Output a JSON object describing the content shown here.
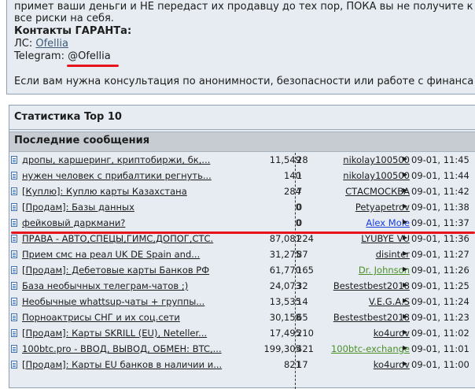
{
  "top": {
    "partial_line": "примет ваши деньги и НЕ передаст их продавцу до тех пор, ПОКА вы не получите к",
    "risk_line": "все риски на себя.",
    "contacts_heading": "Контакты ГАРАНТа:",
    "pm_label": "ЛС:",
    "pm_user": "Ofellia",
    "telegram_label": "Telegram:",
    "telegram_handle": "@Ofellia",
    "consult_line": "Если вам нужна консультация по анонимности, безопасности или работе с финанса"
  },
  "stats": {
    "title": "Статистика Top 10",
    "section": "Последние сообщения"
  },
  "posts": [
    {
      "title": "дропы, каршеринг, криптобиржи, бк,...",
      "views": "11,549",
      "replies": "28",
      "author": "nikolay100500",
      "author_color": "dark",
      "time": "09-01, 11:45"
    },
    {
      "title": "нужен человек с прибалтики регнуть...",
      "views": "140",
      "replies": "1",
      "author": "nikolay100500",
      "author_color": "dark",
      "time": "09-01, 11:44"
    },
    {
      "title": "[Куплю]: Куплю карты Казахстана",
      "views": "284",
      "replies": "7",
      "author": "СТАСМОСКВА",
      "author_color": "dark",
      "time": "09-01, 11:42"
    },
    {
      "title": "[Продам]: Базы данных",
      "views": "0",
      "replies": "0",
      "author": "Petyapetrov",
      "author_color": "dark",
      "time": "09-01, 11:38"
    },
    {
      "title": "фейковый даркмани?",
      "views": "0",
      "replies": "0",
      "author": "Alex Mole",
      "author_color": "blue",
      "time": "09-01, 11:37"
    },
    {
      "title": "ПРАВА - АВТО,СПЕЦЫ,ГИМС,ДОПОГ,СТС.",
      "views": "87,081",
      "replies": "224",
      "author": "LYUBYE VU",
      "author_color": "dark",
      "time": "09-01, 11:36"
    },
    {
      "title": "Прием смс на реал UK DE Spain and...",
      "views": "31,275",
      "replies": "87",
      "author": "disinter",
      "author_color": "dark",
      "time": "09-01, 11:27"
    },
    {
      "title": "[Продам]: Дебетовые карты Банков РФ",
      "views": "61,770",
      "replies": "165",
      "author": "Dr. Johnson",
      "author_color": "green",
      "time": "09-01, 11:26"
    },
    {
      "title": "База необычных телеграм-чатов ;)",
      "views": "24,073",
      "replies": "32",
      "author": "Bestestbest2018",
      "author_color": "dark",
      "time": "09-01, 11:25"
    },
    {
      "title": "Необычные whattsup-чаты + группы...",
      "views": "13,535",
      "replies": "14",
      "author": "V.E.G.A.S",
      "author_color": "dark",
      "time": "09-01, 11:24"
    },
    {
      "title": "Порноактрисы СНГ и их соц.сети",
      "views": "30,158",
      "replies": "65",
      "author": "Bestestbest2018",
      "author_color": "dark",
      "time": "09-01, 11:23"
    },
    {
      "title": "[Продам]: Карты SKRILL (EU), Neteller...",
      "views": "17,495",
      "replies": "210",
      "author": "ko4urov",
      "author_color": "dark",
      "time": "09-01, 11:02"
    },
    {
      "title": "100btc.pro - ВВОД, ВЫВОД, ОБМЕН: BTC,...",
      "views": "199,305",
      "replies": "421",
      "author": "100btc-exchange",
      "author_color": "green",
      "time": "09-01, 11:01"
    },
    {
      "title": "[Продам]: Карты EU банков в наличии и...",
      "views": "821",
      "replies": "17",
      "author": "ko4urov",
      "author_color": "dark",
      "time": "09-01, 11:00"
    }
  ]
}
